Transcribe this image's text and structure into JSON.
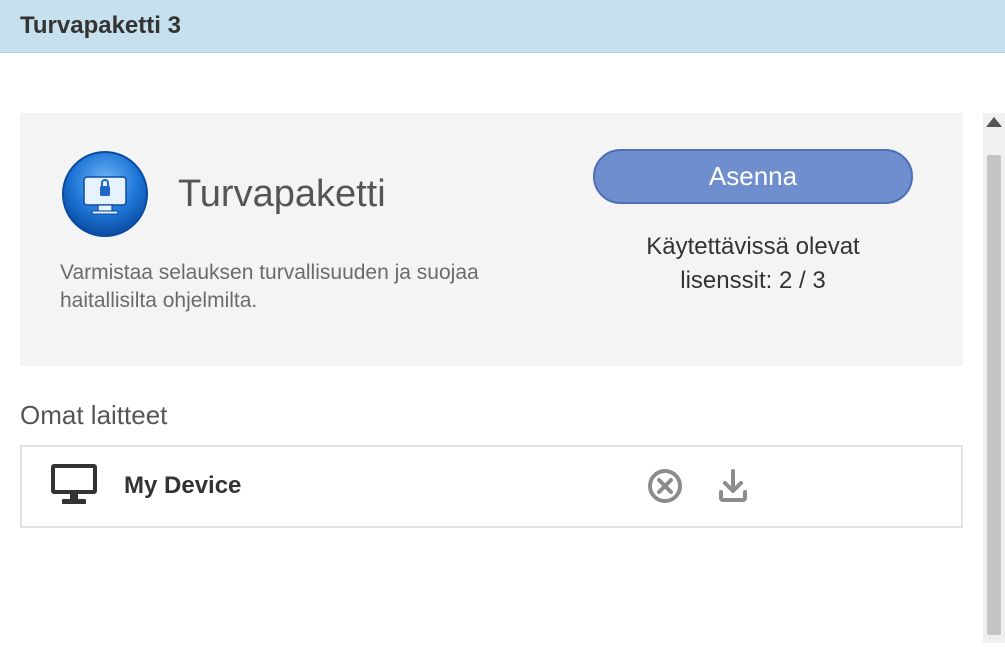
{
  "header": {
    "title": "Turvapaketti 3"
  },
  "product": {
    "title": "Turvapaketti",
    "description": "Varmistaa selauksen turvallisuuden ja suojaa haitallisilta ohjelmilta.",
    "install_label": "Asenna",
    "license_label_line1": "Käytettävissä olevat",
    "license_label_line2_prefix": "lisenssit: ",
    "license_used": 2,
    "license_total": 3
  },
  "devices": {
    "heading": "Omat laitteet",
    "items": [
      {
        "name": "My Device"
      }
    ]
  }
}
